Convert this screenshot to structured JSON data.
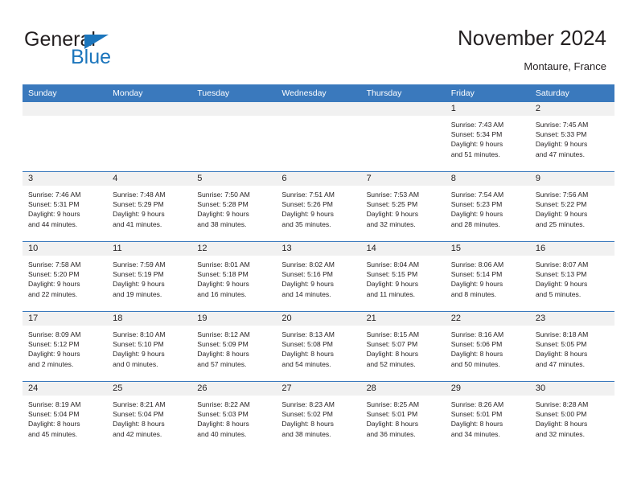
{
  "brand": {
    "word_one": "General",
    "word_two": "Blue",
    "logo_icon": "triangle-logo-icon",
    "accent_color": "#1b75bc"
  },
  "header": {
    "title": "November 2024",
    "subtitle": "Montaure, France"
  },
  "theme": {
    "header_blue": "#3a79bd",
    "daynum_gray": "#f1f1f1",
    "text": "#231f20"
  },
  "weekdays": [
    "Sunday",
    "Monday",
    "Tuesday",
    "Wednesday",
    "Thursday",
    "Friday",
    "Saturday"
  ],
  "weeks": [
    [
      {
        "day": "",
        "sunrise": "",
        "sunset": "",
        "daylight1": "",
        "daylight2": ""
      },
      {
        "day": "",
        "sunrise": "",
        "sunset": "",
        "daylight1": "",
        "daylight2": ""
      },
      {
        "day": "",
        "sunrise": "",
        "sunset": "",
        "daylight1": "",
        "daylight2": ""
      },
      {
        "day": "",
        "sunrise": "",
        "sunset": "",
        "daylight1": "",
        "daylight2": ""
      },
      {
        "day": "",
        "sunrise": "",
        "sunset": "",
        "daylight1": "",
        "daylight2": ""
      },
      {
        "day": "1",
        "sunrise": "Sunrise: 7:43 AM",
        "sunset": "Sunset: 5:34 PM",
        "daylight1": "Daylight: 9 hours",
        "daylight2": "and 51 minutes."
      },
      {
        "day": "2",
        "sunrise": "Sunrise: 7:45 AM",
        "sunset": "Sunset: 5:33 PM",
        "daylight1": "Daylight: 9 hours",
        "daylight2": "and 47 minutes."
      }
    ],
    [
      {
        "day": "3",
        "sunrise": "Sunrise: 7:46 AM",
        "sunset": "Sunset: 5:31 PM",
        "daylight1": "Daylight: 9 hours",
        "daylight2": "and 44 minutes."
      },
      {
        "day": "4",
        "sunrise": "Sunrise: 7:48 AM",
        "sunset": "Sunset: 5:29 PM",
        "daylight1": "Daylight: 9 hours",
        "daylight2": "and 41 minutes."
      },
      {
        "day": "5",
        "sunrise": "Sunrise: 7:50 AM",
        "sunset": "Sunset: 5:28 PM",
        "daylight1": "Daylight: 9 hours",
        "daylight2": "and 38 minutes."
      },
      {
        "day": "6",
        "sunrise": "Sunrise: 7:51 AM",
        "sunset": "Sunset: 5:26 PM",
        "daylight1": "Daylight: 9 hours",
        "daylight2": "and 35 minutes."
      },
      {
        "day": "7",
        "sunrise": "Sunrise: 7:53 AM",
        "sunset": "Sunset: 5:25 PM",
        "daylight1": "Daylight: 9 hours",
        "daylight2": "and 32 minutes."
      },
      {
        "day": "8",
        "sunrise": "Sunrise: 7:54 AM",
        "sunset": "Sunset: 5:23 PM",
        "daylight1": "Daylight: 9 hours",
        "daylight2": "and 28 minutes."
      },
      {
        "day": "9",
        "sunrise": "Sunrise: 7:56 AM",
        "sunset": "Sunset: 5:22 PM",
        "daylight1": "Daylight: 9 hours",
        "daylight2": "and 25 minutes."
      }
    ],
    [
      {
        "day": "10",
        "sunrise": "Sunrise: 7:58 AM",
        "sunset": "Sunset: 5:20 PM",
        "daylight1": "Daylight: 9 hours",
        "daylight2": "and 22 minutes."
      },
      {
        "day": "11",
        "sunrise": "Sunrise: 7:59 AM",
        "sunset": "Sunset: 5:19 PM",
        "daylight1": "Daylight: 9 hours",
        "daylight2": "and 19 minutes."
      },
      {
        "day": "12",
        "sunrise": "Sunrise: 8:01 AM",
        "sunset": "Sunset: 5:18 PM",
        "daylight1": "Daylight: 9 hours",
        "daylight2": "and 16 minutes."
      },
      {
        "day": "13",
        "sunrise": "Sunrise: 8:02 AM",
        "sunset": "Sunset: 5:16 PM",
        "daylight1": "Daylight: 9 hours",
        "daylight2": "and 14 minutes."
      },
      {
        "day": "14",
        "sunrise": "Sunrise: 8:04 AM",
        "sunset": "Sunset: 5:15 PM",
        "daylight1": "Daylight: 9 hours",
        "daylight2": "and 11 minutes."
      },
      {
        "day": "15",
        "sunrise": "Sunrise: 8:06 AM",
        "sunset": "Sunset: 5:14 PM",
        "daylight1": "Daylight: 9 hours",
        "daylight2": "and 8 minutes."
      },
      {
        "day": "16",
        "sunrise": "Sunrise: 8:07 AM",
        "sunset": "Sunset: 5:13 PM",
        "daylight1": "Daylight: 9 hours",
        "daylight2": "and 5 minutes."
      }
    ],
    [
      {
        "day": "17",
        "sunrise": "Sunrise: 8:09 AM",
        "sunset": "Sunset: 5:12 PM",
        "daylight1": "Daylight: 9 hours",
        "daylight2": "and 2 minutes."
      },
      {
        "day": "18",
        "sunrise": "Sunrise: 8:10 AM",
        "sunset": "Sunset: 5:10 PM",
        "daylight1": "Daylight: 9 hours",
        "daylight2": "and 0 minutes."
      },
      {
        "day": "19",
        "sunrise": "Sunrise: 8:12 AM",
        "sunset": "Sunset: 5:09 PM",
        "daylight1": "Daylight: 8 hours",
        "daylight2": "and 57 minutes."
      },
      {
        "day": "20",
        "sunrise": "Sunrise: 8:13 AM",
        "sunset": "Sunset: 5:08 PM",
        "daylight1": "Daylight: 8 hours",
        "daylight2": "and 54 minutes."
      },
      {
        "day": "21",
        "sunrise": "Sunrise: 8:15 AM",
        "sunset": "Sunset: 5:07 PM",
        "daylight1": "Daylight: 8 hours",
        "daylight2": "and 52 minutes."
      },
      {
        "day": "22",
        "sunrise": "Sunrise: 8:16 AM",
        "sunset": "Sunset: 5:06 PM",
        "daylight1": "Daylight: 8 hours",
        "daylight2": "and 50 minutes."
      },
      {
        "day": "23",
        "sunrise": "Sunrise: 8:18 AM",
        "sunset": "Sunset: 5:05 PM",
        "daylight1": "Daylight: 8 hours",
        "daylight2": "and 47 minutes."
      }
    ],
    [
      {
        "day": "24",
        "sunrise": "Sunrise: 8:19 AM",
        "sunset": "Sunset: 5:04 PM",
        "daylight1": "Daylight: 8 hours",
        "daylight2": "and 45 minutes."
      },
      {
        "day": "25",
        "sunrise": "Sunrise: 8:21 AM",
        "sunset": "Sunset: 5:04 PM",
        "daylight1": "Daylight: 8 hours",
        "daylight2": "and 42 minutes."
      },
      {
        "day": "26",
        "sunrise": "Sunrise: 8:22 AM",
        "sunset": "Sunset: 5:03 PM",
        "daylight1": "Daylight: 8 hours",
        "daylight2": "and 40 minutes."
      },
      {
        "day": "27",
        "sunrise": "Sunrise: 8:23 AM",
        "sunset": "Sunset: 5:02 PM",
        "daylight1": "Daylight: 8 hours",
        "daylight2": "and 38 minutes."
      },
      {
        "day": "28",
        "sunrise": "Sunrise: 8:25 AM",
        "sunset": "Sunset: 5:01 PM",
        "daylight1": "Daylight: 8 hours",
        "daylight2": "and 36 minutes."
      },
      {
        "day": "29",
        "sunrise": "Sunrise: 8:26 AM",
        "sunset": "Sunset: 5:01 PM",
        "daylight1": "Daylight: 8 hours",
        "daylight2": "and 34 minutes."
      },
      {
        "day": "30",
        "sunrise": "Sunrise: 8:28 AM",
        "sunset": "Sunset: 5:00 PM",
        "daylight1": "Daylight: 8 hours",
        "daylight2": "and 32 minutes."
      }
    ]
  ]
}
